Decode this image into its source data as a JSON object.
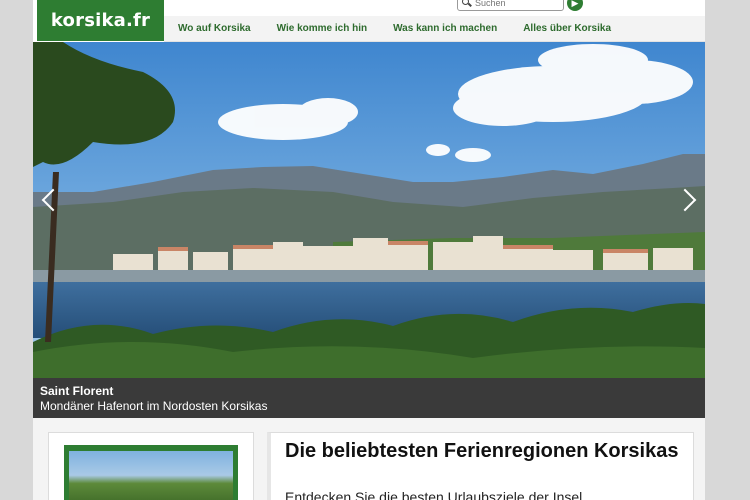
{
  "site": {
    "logo": "korsika.fr"
  },
  "search": {
    "placeholder": "Suchen"
  },
  "nav": {
    "items": [
      "Wo auf Korsika",
      "Wie komme ich hin",
      "Was kann ich machen",
      "Alles über Korsika"
    ]
  },
  "hero": {
    "title": "Saint Florent",
    "subtitle": "Mondäner Hafenort im Nordosten Korsikas"
  },
  "feature": {
    "heading": "Die beliebtesten Ferienregionen Korsikas",
    "subtext": "Entdecken Sie die besten Urlaubsziele der Insel"
  },
  "colors": {
    "brand_green": "#2e7d32",
    "nav_text": "#2e6b2e",
    "caption_bg": "#3a3a3a"
  },
  "icons": [
    "search-icon",
    "arrow-right-icon",
    "chevron-left-icon",
    "chevron-right-icon"
  ]
}
